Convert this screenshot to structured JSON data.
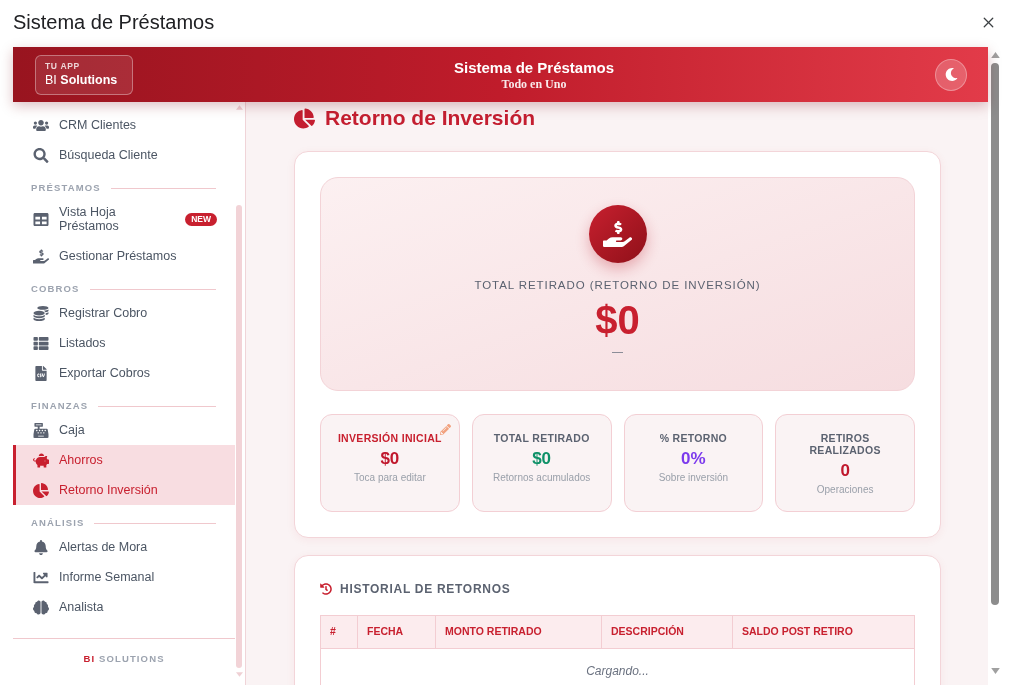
{
  "window": {
    "title": "Sistema de Préstamos"
  },
  "header": {
    "app_label": "TU APP",
    "brand": "BI **Solutions**",
    "title": "Sistema de Préstamos",
    "subtitle": "Todo en Uno"
  },
  "sidebar": {
    "sections": [
      {
        "items": [
          {
            "label": "CRM Clientes",
            "selected": false
          },
          {
            "label": "Búsqueda Cliente",
            "selected": false
          }
        ]
      },
      {
        "title": "PRÉSTAMOS",
        "items": [
          {
            "label": "Vista Hoja Préstamos",
            "badge": "NEW",
            "selected": false
          },
          {
            "label": "Gestionar Préstamos",
            "selected": false
          }
        ]
      },
      {
        "title": "COBROS",
        "items": [
          {
            "label": "Registrar Cobro",
            "selected": false
          },
          {
            "label": "Listados",
            "selected": false
          },
          {
            "label": "Exportar Cobros",
            "selected": false
          }
        ]
      },
      {
        "title": "FINANZAS",
        "items": [
          {
            "label": "Caja",
            "selected": false
          },
          {
            "label": "Ahorros",
            "selected": true
          },
          {
            "label": "Retorno Inversión",
            "selected": true
          }
        ]
      },
      {
        "title": "ANÁLISIS",
        "items": [
          {
            "label": "Alertas de Mora",
            "selected": false
          },
          {
            "label": "Informe Semanal",
            "selected": false
          },
          {
            "label": "Analista",
            "selected": false
          }
        ]
      }
    ],
    "footer": {
      "accent": "BI",
      "text": "SOLUTIONS"
    }
  },
  "page": {
    "title": "Retorno de Inversión"
  },
  "hero": {
    "label": "TOTAL RETIRADO (RETORNO DE INVERSIÓN)",
    "value": "$0",
    "note": "—"
  },
  "stats": [
    {
      "label": "INVERSIÓN INICIAL",
      "value": "$0",
      "caption": "Toca para editar",
      "editable": true,
      "color": "#c0182d"
    },
    {
      "label": "TOTAL RETIRADO",
      "value": "$0",
      "caption": "Retornos acumulados",
      "editable": false,
      "color": "#0f9168"
    },
    {
      "label": "% RETORNO",
      "value": "0%",
      "caption": "Sobre inversión",
      "editable": false,
      "color": "#7c3aed"
    },
    {
      "label": "RETIROS REALIZADOS",
      "value": "0",
      "caption": "Operaciones",
      "editable": false,
      "color": "#c0182d"
    }
  ],
  "history": {
    "title": "HISTORIAL DE RETORNOS",
    "columns": [
      "#",
      "FECHA",
      "MONTO RETIRADO",
      "DESCRIPCIÓN",
      "SALDO POST RETIRO"
    ],
    "empty": "Cargando..."
  }
}
